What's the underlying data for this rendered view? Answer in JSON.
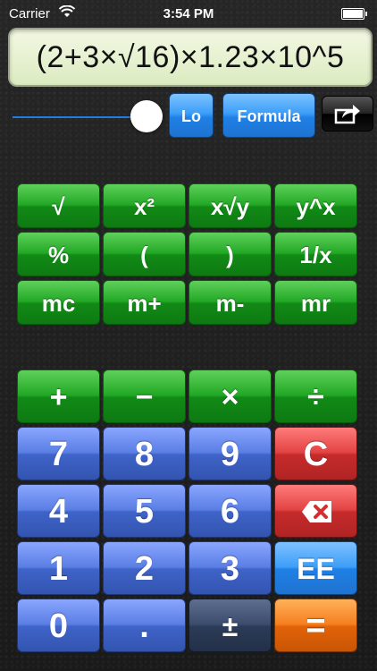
{
  "status": {
    "carrier": "Carrier",
    "time": "3:54 PM"
  },
  "display": {
    "expression": "(2+3×√16)×1.23×10^5"
  },
  "controls": {
    "lo_label": "Lo",
    "formula_label": "Formula",
    "share_icon": "share-icon"
  },
  "keys": {
    "sqrt": "√",
    "square": "x²",
    "root_y": "x√y",
    "pow": "y^x",
    "percent": "%",
    "lparen": "(",
    "rparen": ")",
    "reciprocal": "1/x",
    "mc": "mc",
    "mplus": "m+",
    "mminus": "m-",
    "mr": "mr",
    "plus": "+",
    "minus": "−",
    "times": "×",
    "divide": "÷",
    "d7": "7",
    "d8": "8",
    "d9": "9",
    "clear": "C",
    "d4": "4",
    "d5": "5",
    "d6": "6",
    "d1": "1",
    "d2": "2",
    "d3": "3",
    "ee": "EE",
    "d0": "0",
    "dot": ".",
    "plusminus": "±",
    "equals": "="
  },
  "colors": {
    "green": "#22a825",
    "blue": "#5a7ee4",
    "red": "#e24343",
    "orange": "#f57f1f",
    "accent": "#1d7de5"
  }
}
